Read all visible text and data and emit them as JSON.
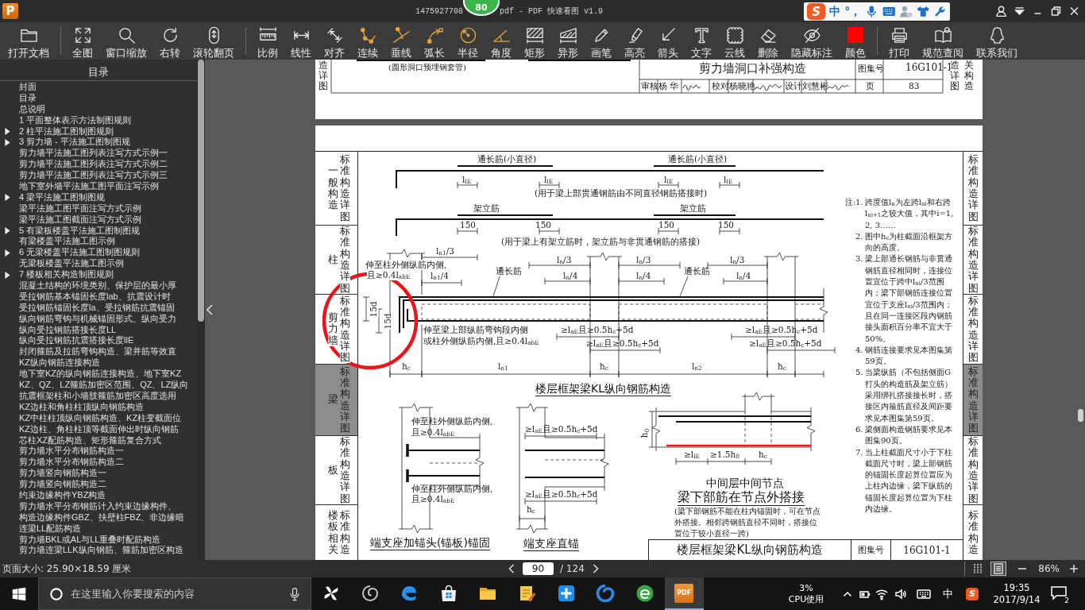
{
  "title_bar": {
    "logo": "P",
    "title_start": "1475927708",
    "floating_ball": "80",
    "title_end": "pdf - PDF 快速看图 v1.9"
  },
  "ime_bar": {
    "logo": "S",
    "mode": "中",
    "punctuation": "°，"
  },
  "toolbar": {
    "groups": [
      [
        {
          "label": "打开文档"
        }
      ],
      [
        {
          "label": "全图"
        },
        {
          "label": "窗口缩放"
        },
        {
          "label": "右转"
        },
        {
          "label": "滚轮翻页"
        }
      ],
      [
        {
          "label": "比例"
        },
        {
          "label": "线性"
        },
        {
          "label": "对齐"
        },
        {
          "label": "连续"
        },
        {
          "label": "垂线"
        },
        {
          "label": "弧长"
        },
        {
          "label": "半径"
        },
        {
          "label": "角度"
        },
        {
          "label": "矩形"
        },
        {
          "label": "异形"
        },
        {
          "label": "画笔"
        },
        {
          "label": "高亮"
        },
        {
          "label": "箭头"
        },
        {
          "label": "文字"
        },
        {
          "label": "云线"
        },
        {
          "label": "删除"
        },
        {
          "label": "隐藏标注"
        },
        {
          "label": "颜色",
          "color": "#ff0000"
        }
      ],
      [
        {
          "label": "打印"
        },
        {
          "label": "规范查阅"
        },
        {
          "label": "联系我们"
        }
      ]
    ]
  },
  "sidebar": {
    "title": "目录",
    "items": [
      {
        "kind": "item",
        "label": "封面"
      },
      {
        "kind": "item",
        "label": "目录"
      },
      {
        "kind": "item",
        "label": "总说明"
      },
      {
        "kind": "item",
        "label": "1 平面整体表示方法制图规则"
      },
      {
        "kind": "group",
        "label": "2 柱平法施工图制图规则"
      },
      {
        "kind": "group",
        "label": "3 剪力墙 - 平法施工图制图规"
      },
      {
        "kind": "item",
        "label": "剪力墙平法施工图列表注写方式示例一"
      },
      {
        "kind": "item",
        "label": "剪力墙平法施工图列表注写方式示例二"
      },
      {
        "kind": "item",
        "label": "剪力墙平法施工图列表注写方式示例三"
      },
      {
        "kind": "item",
        "label": "地下室外墙平法施工图平面注写示例"
      },
      {
        "kind": "group",
        "label": "4 梁平法施工图制图规"
      },
      {
        "kind": "item",
        "label": "梁平法施工图平面注写方式示例"
      },
      {
        "kind": "item",
        "label": "梁平法施工图截面注写方式示例"
      },
      {
        "kind": "group",
        "label": "5 有梁板楼盖平法施工图制图规"
      },
      {
        "kind": "item",
        "label": "有梁楼盖平法施工图示例"
      },
      {
        "kind": "group",
        "label": "6 无梁楼盖平法施工图制图规则"
      },
      {
        "kind": "item",
        "label": "无梁板楼盖平法施工图示例"
      },
      {
        "kind": "group",
        "label": "7 楼板相关构造制图规则"
      },
      {
        "kind": "item",
        "label": "混凝土结构的环境类别、保护层的最小厚"
      },
      {
        "kind": "item",
        "label": "受拉钢筋基本锚固长度lab、抗震设计时"
      },
      {
        "kind": "item",
        "label": "受拉钢筋锚固长度la、受拉钢筋抗震锚固"
      },
      {
        "kind": "item",
        "label": "纵向钢筋弯钩与机械锚固形式、纵向受力"
      },
      {
        "kind": "item",
        "label": "纵向受拉钢筋搭接长度LL"
      },
      {
        "kind": "item",
        "label": "纵向受拉钢筋抗震搭接长度llE"
      },
      {
        "kind": "item",
        "label": "封闭箍筋及拉筋弯钩构造、梁并筋等效直"
      },
      {
        "kind": "item",
        "label": "KZ纵向钢筋连接构造"
      },
      {
        "kind": "item",
        "label": "地下室KZ的纵向钢筋连接构造、地下室KZ"
      },
      {
        "kind": "item",
        "label": "KZ、QZ、LZ箍筋加密区范围、QZ、LZ纵向"
      },
      {
        "kind": "item",
        "label": "抗震框架柱和小墙肢箍筋加密区高度选用"
      },
      {
        "kind": "item",
        "label": "KZ边柱和角柱柱顶纵向钢筋构造"
      },
      {
        "kind": "item",
        "label": "KZ中柱柱顶纵向钢筋构造、KZ柱变截面位"
      },
      {
        "kind": "item",
        "label": "KZ边柱、角柱柱顶等截面伸出时纵向钢筋"
      },
      {
        "kind": "item",
        "label": "芯柱XZ配筋构造、矩形箍筋复合方式"
      },
      {
        "kind": "item",
        "label": "剪力墙水平分布钢筋构造一"
      },
      {
        "kind": "item",
        "label": "剪力墙水平分布钢筋构造二"
      },
      {
        "kind": "item",
        "label": "剪力墙竖向钢筋构造一"
      },
      {
        "kind": "item",
        "label": "剪力墙竖向钢筋构造二"
      },
      {
        "kind": "item",
        "label": "约束边缘构件YBZ构造"
      },
      {
        "kind": "item",
        "label": "剪力墙水平分布钢筋计入约束边缘构件、"
      },
      {
        "kind": "item",
        "label": "构造边缘构件GBZ、扶壁柱FBZ、非边缘暗"
      },
      {
        "kind": "item",
        "label": "连梁LL配筋构造"
      },
      {
        "kind": "item",
        "label": "剪力墙BKL或AL与LL重叠时配筋构造"
      },
      {
        "kind": "item",
        "label": "剪力墙连梁LLK纵向钢筋、箍筋加密区构造"
      }
    ]
  },
  "viewer": {
    "previous_page": {
      "left_tab": "造详图",
      "caption": "(圆形洞口预埋钢套管)",
      "title": "剪力墙洞口补强构造",
      "atlas_label": "图集号",
      "atlas_number": "16G101-1",
      "signoffs": [
        {
          "role": "审核",
          "name": "杨 华"
        },
        {
          "role": "校对",
          "name": "杨晓艳"
        },
        {
          "role": "设计",
          "name": "刘慧彬"
        }
      ],
      "page_label": "页",
      "page_number": "83",
      "right_tabs": [
        "造详图",
        "关构造"
      ]
    },
    "page": {
      "left_tabs": [
        {
          "section": "一般构造",
          "label": "标准构造详图",
          "selected": false
        },
        {
          "section": "柱",
          "label": "标准构造详图",
          "selected": false
        },
        {
          "section": "剪力墙",
          "label": "标准构造详图",
          "selected": false
        },
        {
          "section": "梁",
          "label": "标准构造详图",
          "selected": true
        },
        {
          "section": "板",
          "label": "标准构造详图",
          "selected": false
        },
        {
          "section": "楼板相关",
          "label": "标准构造",
          "selected": false
        }
      ],
      "main_detail": {
        "labels": [
          "通长筋(小直径)",
          "通长筋(小直径)",
          "l$_{lE}$",
          "l$_{lE}$",
          "l$_{lE}$",
          "l$_{lE}$",
          "(用于梁上部贯通钢筋由不同直径钢筋搭接时)",
          "架立筋",
          "架立筋",
          "150",
          "150",
          "150",
          "150",
          "(用于梁上有架立筋时，架立筋与非贯通钢筋的搭接)",
          "l$_{n1}$/3",
          "伸至柱外侧纵筋内侧,",
          "且≥0.4l$_{abE}$",
          "l$_{n1}$/4",
          "通长筋",
          "l$_{n}$/3",
          "l$_{n}$/3",
          "l$_{n}$/3",
          "l$_{n}$/4",
          "l$_{n}$/4",
          "l$_{n}$/4",
          "通长筋",
          "15d",
          "15d",
          "伸至梁上部纵筋弯钩段内侧",
          "或柱外侧纵筋内侧,且≥0.4l$_{abE}$",
          "≥l$_{aE}$且≥0.5h$_{c}$+5d",
          "≥l$_{aE}$且≥0.5h$_{c}$+5d",
          "≥l$_{aE}$且≥0.5h$_{c}$+5d",
          "≥l$_{aE}$且≥0.5h$_{c}$+5d",
          "h$_{c}$",
          "l$_{n1}$",
          "h$_{c}$",
          "l$_{n2}$",
          "h$_{c}$"
        ],
        "title": "楼层框架梁KL纵向钢筋构造"
      },
      "end_anchor_detail": {
        "labels": [
          "伸至柱外侧纵筋内侧,",
          "且≥0.4l$_{abE}$",
          "伸至柱外侧纵筋内侧,",
          "且≥0.4l$_{abE}$"
        ],
        "title": "端支座加锚头(锚板)锚固"
      },
      "straight_anchor_detail": {
        "labels": [
          "≥l$_{aE}$且≥0.5h$_{c}$+5d",
          "≥l$_{aE}$且≥0.5h$_{c}$+5d",
          "h$_{c}$"
        ],
        "title": "端支座直锚"
      },
      "joint_detail": {
        "labels": [
          "h$_{0}$",
          "≥l$_{lE}$",
          "≥1.5h$_{0}$",
          "h$_{c}$"
        ],
        "title": "中间层中间节点",
        "subtitle": "梁下部筋在节点外搭接",
        "note": "(梁下部钢筋不能在柱内锚固时，可在节点外搭接。相邻跨钢筋直径不同时，搭接位置位于较小直径一跨)"
      },
      "notes": {
        "heading": "注:",
        "items": [
          {
            "number": "1.",
            "text": "跨度值l$_{n}$为左跨l$_{ni}$和右跨l$_{ni+1}$之较大值，其中i=1, 2, 3……"
          },
          {
            "number": "2.",
            "text": "图中h$_{c}$为柱截面沿框架方向的高度。"
          },
          {
            "number": "3.",
            "text": "梁上部通长钢筋与非贯通钢筋直径相同时，连接位置宜位于跨中l$_{ni}$/3范围内；梁下部钢筋连接位置宜位于支座l$_{ni}$/3范围内；且在同一连接区段内钢筋接头面积百分率不宜大于50%。"
          },
          {
            "number": "4.",
            "text": "钢筋连接要求见本图集第59页。"
          },
          {
            "number": "5.",
            "text": "当梁纵筋（不包括侧面G打头的构造筋及架立筋）采用绑扎搭接接长时，搭接区内箍筋直径及间距要求见本图集第59页。"
          },
          {
            "number": "6.",
            "text": "梁侧面构造钢筋要求见本图集90页。"
          },
          {
            "number": "7.",
            "text": "当上柱截面尺寸小于下柱截面尺寸时，梁上部钢筋的锚固长度起算位置应为上柱内边缘，梁下纵筋的锚固长度起算位置为下柱内边缘。"
          }
        ]
      },
      "title_block": {
        "title": "楼层框架梁KL纵向钢筋构造",
        "atlas_label": "图集号",
        "atlas_number": "16G101-1"
      },
      "right_tabs": [
        {
          "label": "标准构造详图",
          "selected": false
        },
        {
          "label": "标准构造详图",
          "selected": false
        },
        {
          "label": "标准构造详图",
          "selected": false
        },
        {
          "label": "标准构造详图",
          "selected": true
        },
        {
          "label": "标准构造详图",
          "selected": false
        },
        {
          "label": "标准构造",
          "selected": false
        }
      ]
    }
  },
  "status_bar": {
    "page_size": "页面大小: 25.90×18.59 厘米",
    "page_input": "90",
    "page_count": "/ 124",
    "view_modes": [
      {
        "selected": false
      },
      {
        "selected": true
      }
    ],
    "zoom": "86%"
  },
  "taskbar": {
    "search": {
      "placeholder": "在这里输入你要搜索的内容"
    },
    "apps": [
      {
        "kind": "pinwheel",
        "selected": false
      },
      {
        "kind": "swirl",
        "selected": false
      },
      {
        "kind": "browser",
        "selected": false
      },
      {
        "kind": "store",
        "selected": false
      },
      {
        "kind": "folder",
        "selected": false
      },
      {
        "kind": "notepad",
        "selected": false
      },
      {
        "kind": "toolbox",
        "selected": false
      },
      {
        "kind": "ring",
        "selected": false
      },
      {
        "kind": "globe",
        "selected": false
      },
      {
        "kind": "pdf",
        "label": "PDF",
        "selected": true
      }
    ],
    "cpu_value": "3%",
    "cpu_label": "CPU使用",
    "ime_mode": "中",
    "ime_logo": "S",
    "time": "19:35",
    "date": "2017/9/14",
    "notifications": "2"
  }
}
